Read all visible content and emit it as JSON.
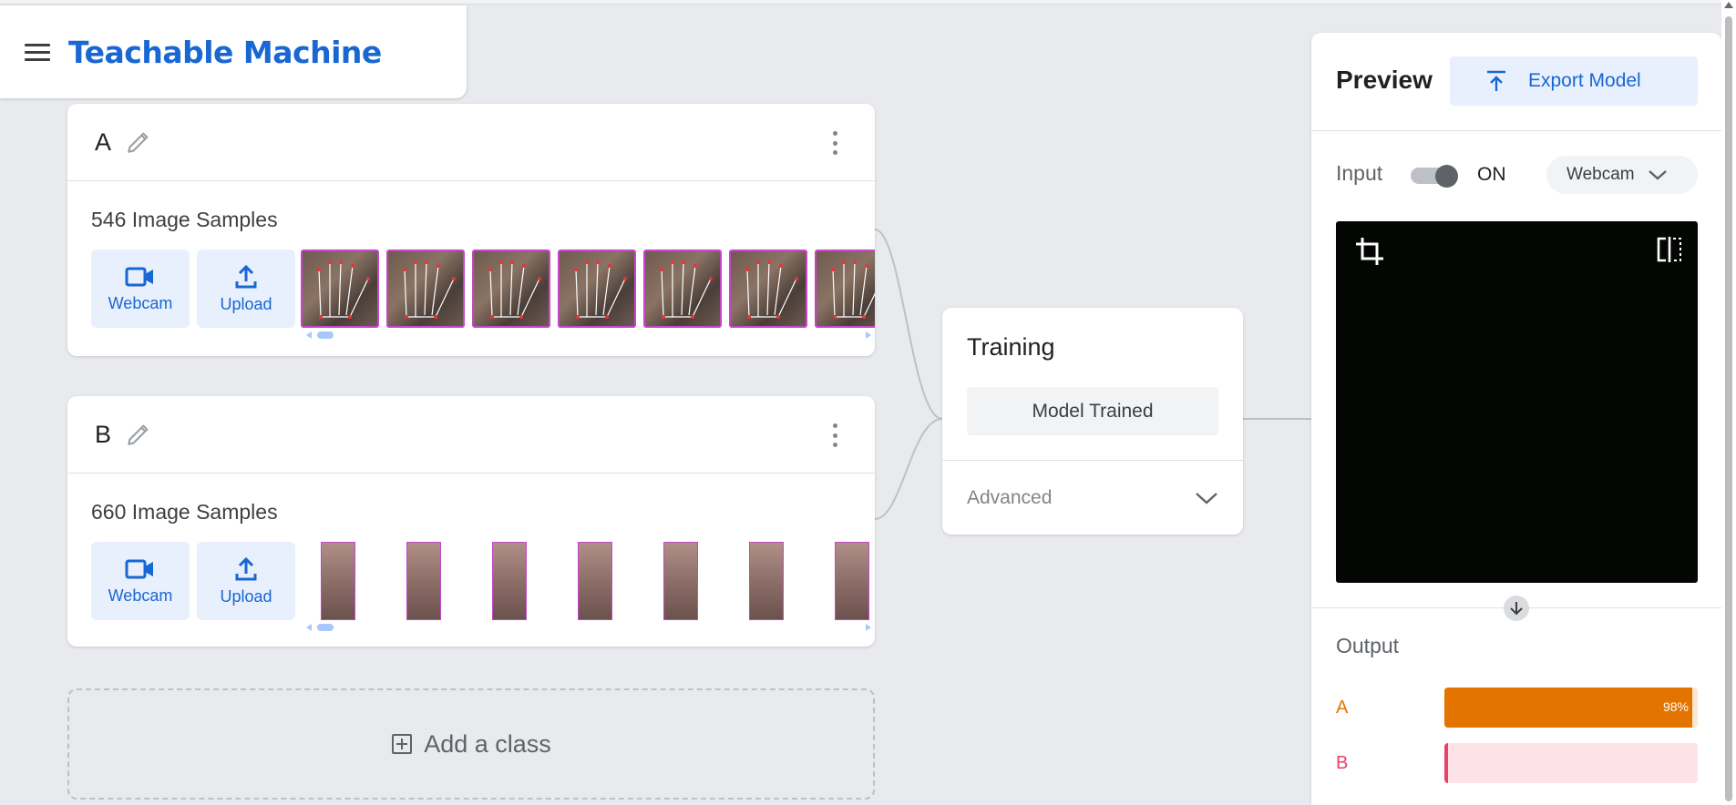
{
  "app": {
    "title": "Teachable Machine"
  },
  "classes": [
    {
      "name": "A",
      "samples_label": "546 Image Samples",
      "webcam_label": "Webcam",
      "upload_label": "Upload"
    },
    {
      "name": "B",
      "samples_label": "660 Image Samples",
      "webcam_label": "Webcam",
      "upload_label": "Upload"
    }
  ],
  "add_class": {
    "label": "Add a class"
  },
  "training": {
    "title": "Training",
    "status_button": "Model Trained",
    "advanced_label": "Advanced"
  },
  "preview": {
    "title": "Preview",
    "export_label": "Export Model",
    "input_label": "Input",
    "input_state": "ON",
    "input_source": "Webcam",
    "output_label": "Output",
    "outputs": [
      {
        "name": "A",
        "percent": 98,
        "percent_label": "98%",
        "color": "#e37400",
        "bg": "#fce8d0"
      },
      {
        "name": "B",
        "percent": 1,
        "percent_label": "",
        "color": "#e8426b",
        "bg": "#fde2e7"
      }
    ]
  },
  "colors": {
    "brand": "#1967d2",
    "accent_bg": "#e8f0fe",
    "sample_border": "#c547c8"
  },
  "icons": [
    "menu-icon",
    "edit-icon",
    "more-vert-icon",
    "videocam-icon",
    "upload-icon",
    "add-box-icon",
    "chevron-down-icon",
    "export-icon",
    "crop-icon",
    "flip-icon",
    "arrow-down-icon"
  ]
}
